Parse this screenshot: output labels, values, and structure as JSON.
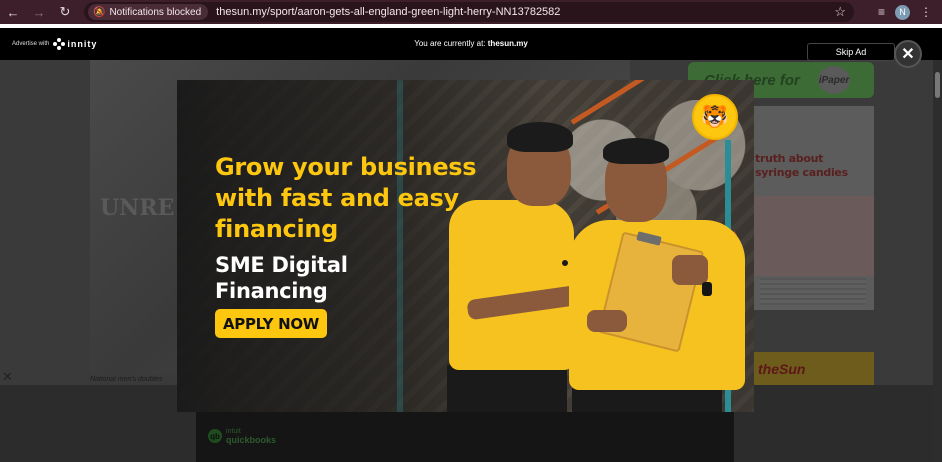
{
  "browser": {
    "back_icon": "arrow-left-icon",
    "forward_icon": "arrow-right-icon",
    "reload_icon": "reload-icon",
    "notifications_chip": "Notifications blocked",
    "url": "thesun.my/sport/aaron-gets-all-england-green-light-herry-NN13782582",
    "profile_initial": "N"
  },
  "adbar": {
    "advertise_label": "Advertise with",
    "innity_label": "innity",
    "currently_prefix": "You are currently at:",
    "currently_site": "thesun.my",
    "skip_label": "Skip Ad",
    "close_glyph": "✕"
  },
  "ad": {
    "headline_lines": [
      "Grow your business",
      "with fast and easy",
      "financing"
    ],
    "subhead_lines": [
      "SME Digital",
      "Financing"
    ],
    "cta_label": "APPLY NOW",
    "brand_color": "#fdc60f"
  },
  "background_page": {
    "ipaper_label": "Click here for",
    "ipaper_badge": "iPaper",
    "newspaper_headline_1": "truth about",
    "newspaper_headline_2": "syringe candies",
    "sun_label": "theSun",
    "caption": "National men's doubles",
    "qb_line1": "intuit",
    "qb_line2": "quickbooks"
  }
}
